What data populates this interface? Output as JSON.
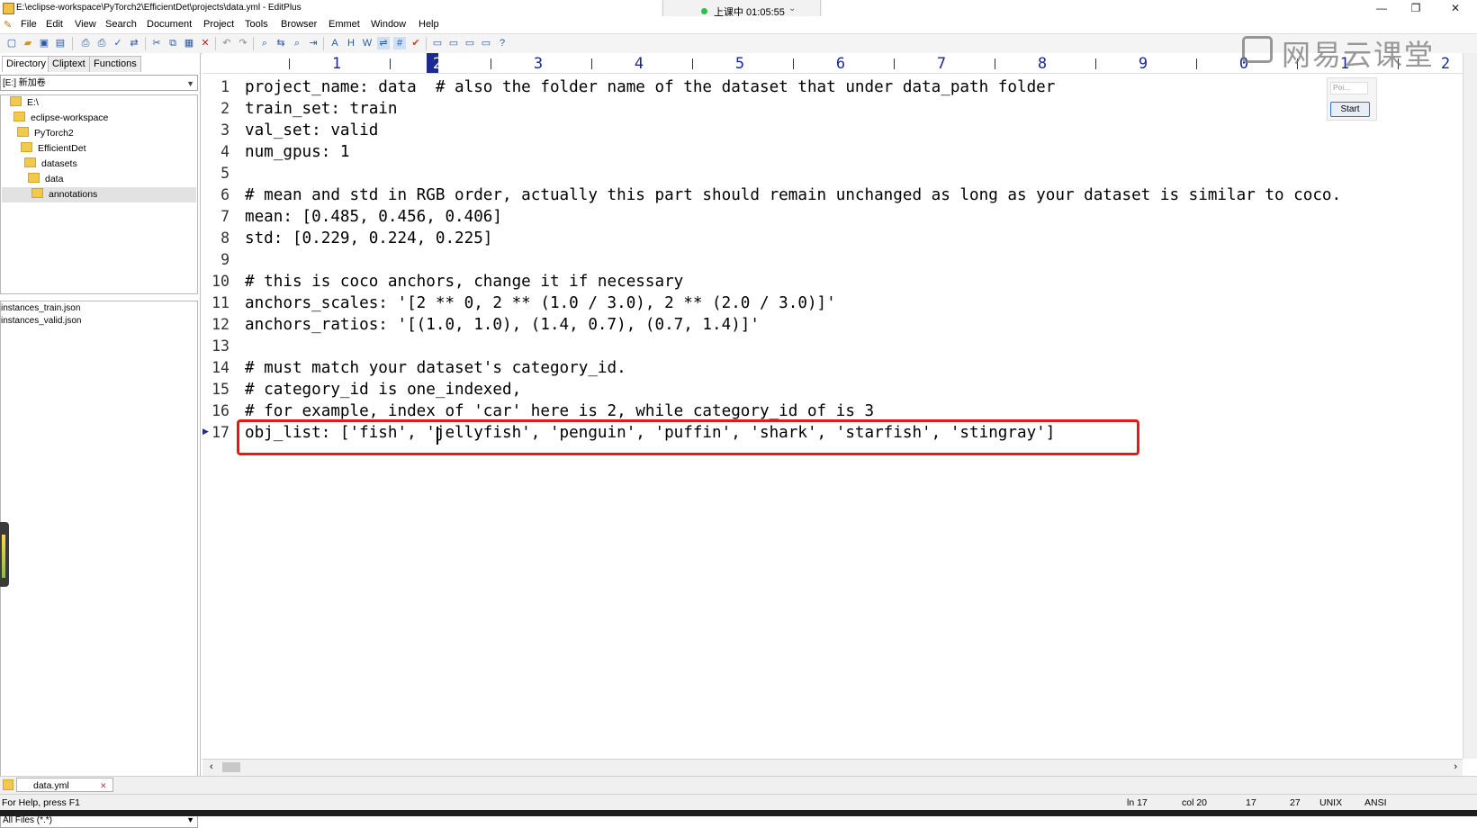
{
  "window": {
    "title": "E:\\eclipse-workspace\\PyTorch2\\EfficientDet\\projects\\data.yml - EditPlus",
    "minimize": "—",
    "restore": "❐",
    "close": "✕"
  },
  "menu": [
    "File",
    "Edit",
    "View",
    "Search",
    "Document",
    "Project",
    "Tools",
    "Browser",
    "Emmet",
    "Window",
    "Help"
  ],
  "recording": {
    "text": "上课中 01:05:55",
    "chevron": "⌄",
    "dot_color": "#2cbf4a"
  },
  "watermark": {
    "text": "网易云课堂"
  },
  "sidebar": {
    "tabs": [
      "Directory",
      "Cliptext",
      "Functions"
    ],
    "drive": "[E:] 新加卷",
    "tree": [
      "E:\\",
      "eclipse-workspace",
      "PyTorch2",
      "EfficientDet",
      "datasets",
      "data",
      "annotations"
    ],
    "files": [
      "instances_train.json",
      "instances_valid.json"
    ],
    "filter": "All Files (*.*)"
  },
  "ruler": {
    "numbers": [
      "1",
      "2",
      "3",
      "4",
      "5",
      "6",
      "7",
      "8",
      "9",
      "0",
      "1",
      "2"
    ],
    "current_index": 1
  },
  "editor": {
    "lines": [
      {
        "n": "1",
        "text": "project_name: data  # also the folder name of the dataset that under data_path folder"
      },
      {
        "n": "2",
        "text": "train_set: train"
      },
      {
        "n": "3",
        "text": "val_set: valid"
      },
      {
        "n": "4",
        "text": "num_gpus: 1"
      },
      {
        "n": "5",
        "text": ""
      },
      {
        "n": "6",
        "text": "# mean and std in RGB order, actually this part should remain unchanged as long as your dataset is similar to coco."
      },
      {
        "n": "7",
        "text": "mean: [0.485, 0.456, 0.406]"
      },
      {
        "n": "8",
        "text": "std: [0.229, 0.224, 0.225]"
      },
      {
        "n": "9",
        "text": ""
      },
      {
        "n": "10",
        "text": "# this is coco anchors, change it if necessary"
      },
      {
        "n": "11",
        "text": "anchors_scales: '[2 ** 0, 2 ** (1.0 / 3.0), 2 ** (2.0 / 3.0)]'"
      },
      {
        "n": "12",
        "text": "anchors_ratios: '[(1.0, 1.0), (1.4, 0.7), (0.7, 1.4)]'"
      },
      {
        "n": "13",
        "text": ""
      },
      {
        "n": "14",
        "text": "# must match your dataset's category_id."
      },
      {
        "n": "15",
        "text": "# category_id is one_indexed,"
      },
      {
        "n": "16",
        "text": "# for example, index of 'car' here is 2, while category_id of is 3"
      },
      {
        "n": "17",
        "text": "obj_list: ['fish', 'jellyfish', 'penguin', 'puffin', 'shark', 'starfish', 'stingray']"
      }
    ],
    "bookmark_line": "17",
    "highlight_color": "#e01b1b"
  },
  "mini_panel": {
    "placeholder": "Poi...",
    "start_label": "Start"
  },
  "doc_tab": {
    "name": "data.yml",
    "close": "✕"
  },
  "status": {
    "help": "For Help, press F1",
    "ln": "ln 17",
    "col": "col 20",
    "lines": "17",
    "chars": "27",
    "eol": "UNIX",
    "encoding": "ANSI"
  }
}
